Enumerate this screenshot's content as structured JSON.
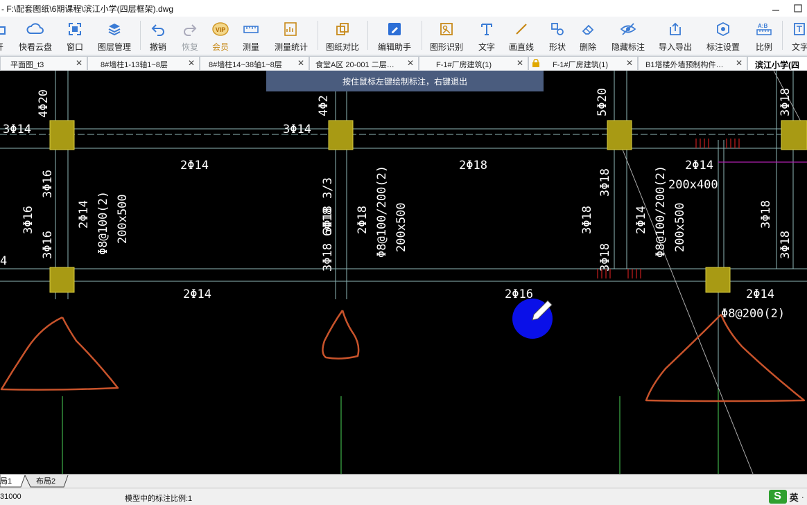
{
  "window": {
    "title": "- F:\\配套图纸\\6期课程\\滨江小学(四层框架).dwg"
  },
  "toolbar": {
    "items": [
      {
        "label": "开",
        "icon": "open-icon"
      },
      {
        "label": "快看云盘",
        "icon": "cloud-icon"
      },
      {
        "label": "窗口",
        "icon": "window-icon"
      },
      {
        "label": "图层管理",
        "icon": "layers-icon"
      },
      {
        "label": "撤销",
        "icon": "undo-icon"
      },
      {
        "label": "恢复",
        "icon": "redo-icon"
      },
      {
        "label": "会员",
        "icon": "vip-icon"
      },
      {
        "label": "测量",
        "icon": "measure-icon"
      },
      {
        "label": "测量统计",
        "icon": "measure-stats-icon"
      },
      {
        "label": "图纸对比",
        "icon": "compare-icon"
      },
      {
        "label": "编辑助手",
        "icon": "edit-assistant-icon"
      },
      {
        "label": "图形识别",
        "icon": "shape-recognize-icon"
      },
      {
        "label": "文字",
        "icon": "text-icon"
      },
      {
        "label": "画直线",
        "icon": "line-icon"
      },
      {
        "label": "形状",
        "icon": "shape-icon"
      },
      {
        "label": "删除",
        "icon": "eraser-icon"
      },
      {
        "label": "隐藏标注",
        "icon": "hide-annotation-icon"
      },
      {
        "label": "导入导出",
        "icon": "import-export-icon"
      },
      {
        "label": "标注设置",
        "icon": "annotation-settings-icon"
      },
      {
        "label": "比例",
        "icon": "scale-icon"
      },
      {
        "label": "文字",
        "icon": "text-search-icon"
      }
    ]
  },
  "tabs": [
    {
      "label": "平面图_t3"
    },
    {
      "label": "8#墙柱1-13轴1~8层"
    },
    {
      "label": "8#墙柱14~38轴1~8层"
    },
    {
      "label": "食堂A区 20-001 二层…"
    },
    {
      "label": "F-1#厂房建筑(1)"
    },
    {
      "label": "F-1#厂房建筑(1)"
    },
    {
      "label": "B1塔楼外墙预制构件…"
    },
    {
      "label": "滨江小学(四"
    }
  ],
  "hint": "按住鼠标左键绘制标注，右键退出",
  "drawing": {
    "labels": [
      "4Φ20",
      "4Φ2",
      "5Φ20",
      "3Φ18",
      "3Φ14",
      "3Φ14",
      "2Φ14",
      "2Φ18",
      "2Φ14",
      "200x400",
      "3Φ16",
      "3Φ16",
      "3Φ16",
      "2Φ14",
      "Φ8@100(2)",
      "200x500",
      "3Φ18 3/3",
      "3Φ18 6Φ18",
      "2Φ18",
      "Φ8@100/200(2)",
      "200x500",
      "3Φ18",
      "3Φ18",
      "3Φ18",
      "2Φ14",
      "Φ8@100/200(2)",
      "200x500",
      "3Φ18",
      "3Φ18",
      "4",
      "2Φ14",
      "2Φ16",
      "2Φ14",
      "Φ8@200(2)"
    ]
  },
  "layout_tabs": [
    "局1",
    "布局2"
  ],
  "status": {
    "coord": "31000",
    "scale": "模型中的标注比例:1",
    "ime_label": "英",
    "ime_logo": "S"
  },
  "colors": {
    "column_fill": "#a89a14",
    "beam_line": "#8fb8b8",
    "grid_line": "#3fb24a",
    "text_white": "#ffffff",
    "sketch_red": "#c8532b",
    "cursor_blue": "#0a10e8",
    "magenta": "#b020b0",
    "red_marks": "#c81e1e",
    "hint_bg": "#4a5c7e"
  }
}
